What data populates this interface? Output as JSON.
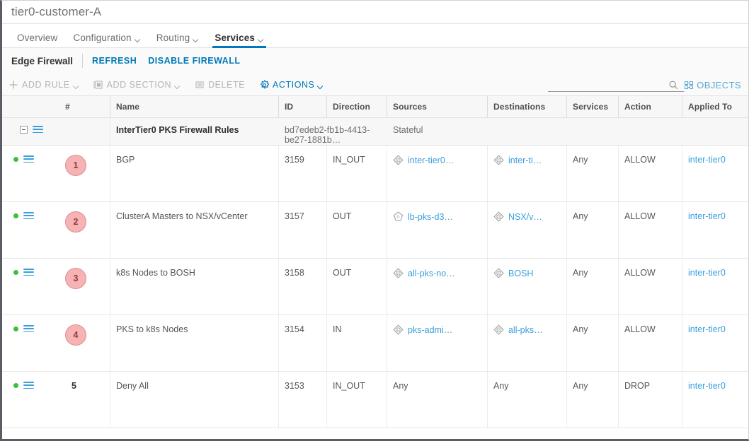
{
  "window": {
    "title": "tier0-customer-A"
  },
  "tabs": [
    {
      "label": "Overview",
      "has_caret": false,
      "active": false
    },
    {
      "label": "Configuration",
      "has_caret": true,
      "active": false
    },
    {
      "label": "Routing",
      "has_caret": true,
      "active": false
    },
    {
      "label": "Services",
      "has_caret": true,
      "active": true
    }
  ],
  "firewall_header": {
    "title": "Edge Firewall",
    "refresh_label": "REFRESH",
    "disable_label": "DISABLE FIREWALL"
  },
  "toolbar": {
    "add_rule_label": "ADD RULE",
    "add_section_label": "ADD SECTION",
    "delete_label": "DELETE",
    "actions_label": "ACTIONS",
    "objects_label": "OBJECTS",
    "search_value": "",
    "search_placeholder": ""
  },
  "table": {
    "columns": [
      "",
      "#",
      "Name",
      "ID",
      "Direction",
      "Sources",
      "Destinations",
      "Services",
      "Action",
      "Applied To"
    ],
    "section": {
      "name": "InterTier0 PKS Firewall Rules",
      "id": "bd7edeb2-fb1b-4413-be27-1881b…",
      "statefulness": "Stateful"
    },
    "rows": [
      {
        "status": "enabled",
        "number": "1",
        "badge": true,
        "name": "BGP",
        "id": "3159",
        "direction": "IN_OUT",
        "source": {
          "label": "inter-tier0…",
          "icon": "ipset-icon",
          "link": true
        },
        "destination": {
          "label": "inter-ti…",
          "icon": "ipset-icon",
          "link": true
        },
        "services": "Any",
        "action": "ALLOW",
        "applied_to": "inter-tier0"
      },
      {
        "status": "enabled",
        "number": "2",
        "badge": true,
        "name": "ClusterA Masters to NSX/vCenter",
        "id": "3157",
        "direction": "OUT",
        "source": {
          "label": "lb-pks-d3…",
          "icon": "group-icon",
          "link": true
        },
        "destination": {
          "label": "NSX/v…",
          "icon": "ipset-icon",
          "link": true
        },
        "services": "Any",
        "action": "ALLOW",
        "applied_to": "inter-tier0"
      },
      {
        "status": "enabled",
        "number": "3",
        "badge": true,
        "name": "k8s Nodes to BOSH",
        "id": "3158",
        "direction": "OUT",
        "source": {
          "label": "all-pks-no…",
          "icon": "ipset-icon",
          "link": true
        },
        "destination": {
          "label": "BOSH",
          "icon": "ipset-icon",
          "link": true
        },
        "services": "Any",
        "action": "ALLOW",
        "applied_to": "inter-tier0"
      },
      {
        "status": "enabled",
        "number": "4",
        "badge": true,
        "name": "PKS to k8s Nodes",
        "id": "3154",
        "direction": "IN",
        "source": {
          "label": "pks-admi…",
          "icon": "ipset-icon",
          "link": true
        },
        "destination": {
          "label": "all-pks…",
          "icon": "ipset-icon",
          "link": true
        },
        "services": "Any",
        "action": "ALLOW",
        "applied_to": "inter-tier0"
      },
      {
        "status": "enabled",
        "number": "5",
        "badge": false,
        "name": "Deny All",
        "id": "3153",
        "direction": "IN_OUT",
        "source": {
          "label": "Any",
          "icon": null,
          "link": false
        },
        "destination": {
          "label": "Any",
          "icon": null,
          "link": false
        },
        "services": "Any",
        "action": "DROP",
        "applied_to": "inter-tier0"
      }
    ]
  },
  "colors": {
    "accent_blue": "#0079b8",
    "link_blue": "#3a9fdb",
    "status_green": "#3ac13a",
    "badge_fill": "#f7b3b3",
    "badge_border": "#dd8f91",
    "badge_text": "#8a3a3e"
  }
}
